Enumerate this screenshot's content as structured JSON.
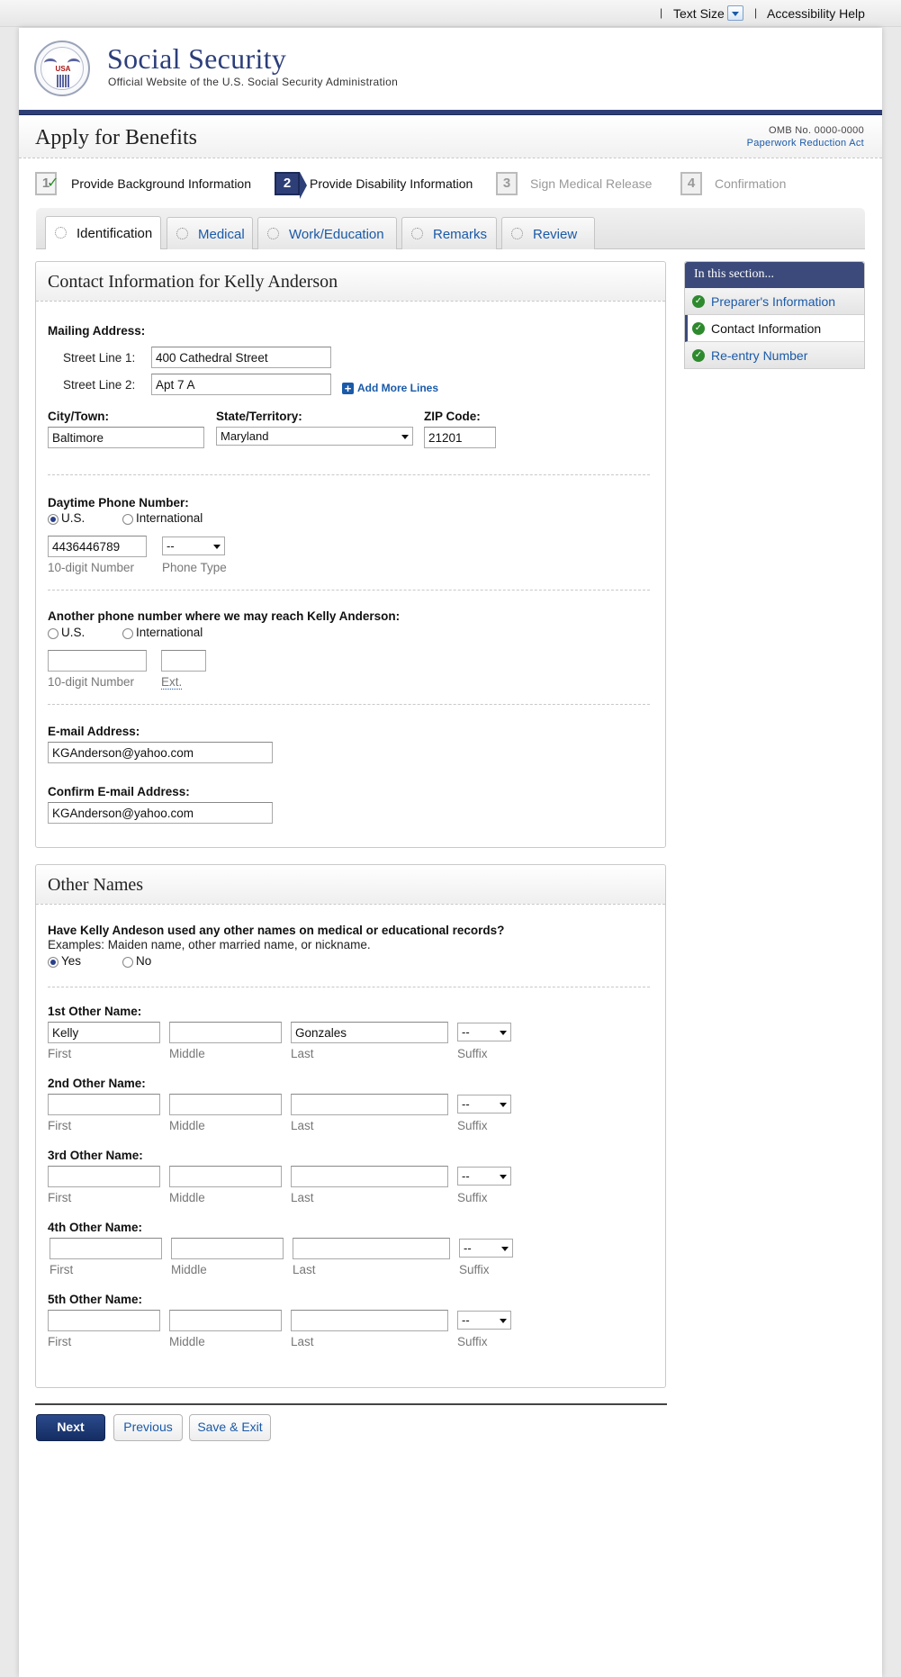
{
  "utility": {
    "separator": "|",
    "text_size_label": "Text Size",
    "accessibility_label": "Accessibility Help"
  },
  "brand": {
    "seal_text": "USA",
    "title": "Social Security",
    "subtitle": "Official Website of the U.S. Social Security Administration"
  },
  "page_header": {
    "title": "Apply for Benefits",
    "omb": "OMB No. 0000-0000",
    "paperwork_link": "Paperwork Reduction Act"
  },
  "steps": [
    {
      "number": "1",
      "label": "Provide Background Information",
      "state": "done"
    },
    {
      "number": "2",
      "label": "Provide Disability Information",
      "state": "current"
    },
    {
      "number": "3",
      "label": "Sign Medical Release",
      "state": "pending"
    },
    {
      "number": "4",
      "label": "Confirmation",
      "state": "pending"
    }
  ],
  "tabs": [
    {
      "label": "Identification",
      "active": true
    },
    {
      "label": "Medical",
      "active": false
    },
    {
      "label": "Work/Education",
      "active": false
    },
    {
      "label": "Remarks",
      "active": false
    },
    {
      "label": "Review",
      "active": false
    }
  ],
  "contact": {
    "title": "Contact Information for Kelly Anderson",
    "mailing_label": "Mailing Address:",
    "street1_label": "Street Line 1:",
    "street1_value": "400 Cathedral Street",
    "street2_label": "Street Line 2:",
    "street2_value": "Apt 7 A",
    "add_more_lines": "Add More Lines",
    "city_label": "City/Town:",
    "city_value": "Baltimore",
    "state_label": "State/Territory:",
    "state_value": "Maryland",
    "zip_label": "ZIP Code:",
    "zip_value": "21201",
    "day_phone_label": "Daytime Phone Number:",
    "us_label": "U.S.",
    "intl_label": "International",
    "day_phone_value": "4436446789",
    "phone_type_value": "--",
    "ten_digit_hint": "10-digit Number",
    "phone_type_hint": "Phone Type",
    "alt_phone_label": "Another phone number where we may reach Kelly Anderson:",
    "ext_hint": "Ext.",
    "email_label": "E-mail Address:",
    "email_value": "KGAnderson@yahoo.com",
    "confirm_email_label": "Confirm E-mail Address:",
    "confirm_email_value": "KGAnderson@yahoo.com"
  },
  "other_names": {
    "title": "Other Names",
    "question": "Have Kelly Andeson used any other names on medical or educational records?",
    "examples": "Examples: Maiden name, other married name, or nickname.",
    "yes_label": "Yes",
    "no_label": "No",
    "hints": {
      "first": "First",
      "middle": "Middle",
      "last": "Last",
      "suffix": "Suffix"
    },
    "entries": [
      {
        "label": "1st Other Name:",
        "first": "Kelly",
        "middle": "",
        "last": "Gonzales",
        "suffix": "--"
      },
      {
        "label": "2nd Other Name:",
        "first": "",
        "middle": "",
        "last": "",
        "suffix": "--"
      },
      {
        "label": "3rd Other Name:",
        "first": "",
        "middle": "",
        "last": "",
        "suffix": "--"
      },
      {
        "label": "4th Other Name:",
        "first": "",
        "middle": "",
        "last": "",
        "suffix": "--"
      },
      {
        "label": "5th Other Name:",
        "first": "",
        "middle": "",
        "last": "",
        "suffix": "--"
      }
    ]
  },
  "sidebar": {
    "title": "In this section...",
    "items": [
      {
        "label": "Preparer's Information",
        "current": false
      },
      {
        "label": "Contact Information",
        "current": true
      },
      {
        "label": "Re-entry Number",
        "current": false
      }
    ]
  },
  "buttons": {
    "next": "Next",
    "previous": "Previous",
    "save_exit": "Save & Exit"
  },
  "colors": {
    "brand_navy": "#2e3f78",
    "link_blue": "#1a5aa8",
    "check_green": "#2d8a2d"
  }
}
